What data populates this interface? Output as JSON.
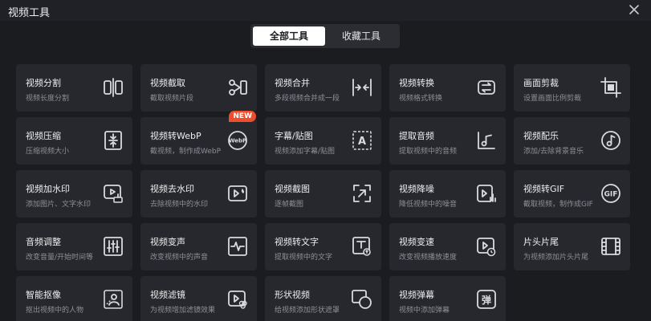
{
  "window": {
    "title": "视频工具"
  },
  "tabs": [
    {
      "label": "全部工具",
      "active": true
    },
    {
      "label": "收藏工具",
      "active": false
    }
  ],
  "tools": [
    {
      "name": "视频分割",
      "desc": "视频长度分割",
      "icon": "split-icon"
    },
    {
      "name": "视频截取",
      "desc": "截取视频片段",
      "icon": "scissors-icon"
    },
    {
      "name": "视频合并",
      "desc": "多段视频合并成一段",
      "icon": "merge-icon"
    },
    {
      "name": "视频转换",
      "desc": "视频格式转换",
      "icon": "convert-icon"
    },
    {
      "name": "画面剪裁",
      "desc": "设置画面比例剪裁",
      "icon": "crop-icon"
    },
    {
      "name": "视频压缩",
      "desc": "压缩视频大小",
      "icon": "compress-icon"
    },
    {
      "name": "视频转WebP",
      "desc": "截视频，制作成WebP",
      "icon": "webp-icon",
      "badge": "NEW"
    },
    {
      "name": "字幕/贴图",
      "desc": "视频添加字幕/贴图",
      "icon": "subtitle-icon"
    },
    {
      "name": "提取音频",
      "desc": "提取视频中的音频",
      "icon": "music-note-icon"
    },
    {
      "name": "视频配乐",
      "desc": "添加/去除背景音乐",
      "icon": "music-circle-icon"
    },
    {
      "name": "视频加水印",
      "desc": "添加图片、文字水印",
      "icon": "add-watermark-icon"
    },
    {
      "name": "视频去水印",
      "desc": "去除视频中的水印",
      "icon": "remove-watermark-icon"
    },
    {
      "name": "视频截图",
      "desc": "逐帧截图",
      "icon": "screenshot-icon"
    },
    {
      "name": "视频降噪",
      "desc": "降低视频中的噪音",
      "icon": "denoise-icon"
    },
    {
      "name": "视频转GIF",
      "desc": "截取视频，制作成GIF",
      "icon": "gif-icon"
    },
    {
      "name": "音频调整",
      "desc": "改变音量/开始时间等",
      "icon": "equalizer-icon"
    },
    {
      "name": "视频变声",
      "desc": "改变视频中的声音",
      "icon": "voice-change-icon"
    },
    {
      "name": "视频转文字",
      "desc": "提取视频中的文字",
      "icon": "video-to-text-icon"
    },
    {
      "name": "视频变速",
      "desc": "改变视频播放速度",
      "icon": "speed-icon"
    },
    {
      "name": "片头片尾",
      "desc": "为视频添加片头片尾",
      "icon": "film-icon"
    },
    {
      "name": "智能抠像",
      "desc": "抠出视频中的人物",
      "icon": "portrait-cutout-icon"
    },
    {
      "name": "视频滤镜",
      "desc": "为视频增加滤镜效果",
      "icon": "filter-icon"
    },
    {
      "name": "形状视频",
      "desc": "给视频添加形状遮罩",
      "icon": "shape-icon"
    },
    {
      "name": "视频弹幕",
      "desc": "视频中添加弹幕",
      "icon": "danmaku-icon"
    }
  ]
}
